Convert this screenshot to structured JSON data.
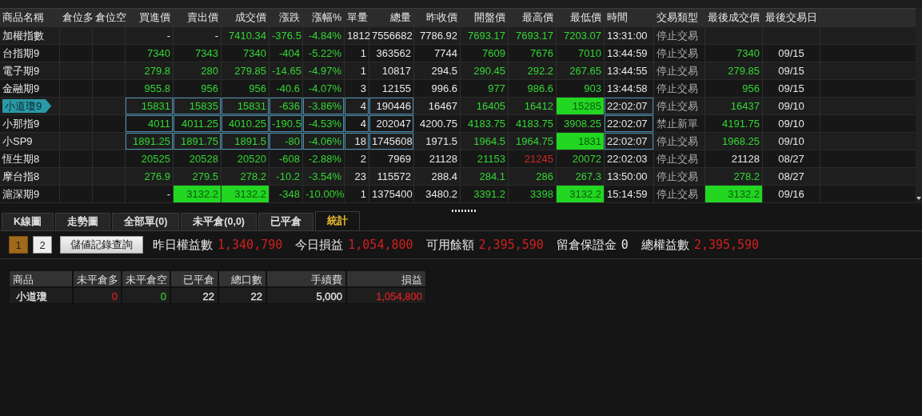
{
  "quotes": {
    "columns": [
      "商品名稱",
      "倉位多",
      "倉位空",
      "買進價",
      "賣出價",
      "成交價",
      "漲跌",
      "漲幅%",
      "單量",
      "總量",
      "昨收價",
      "開盤價",
      "最高價",
      "最低價",
      "時間",
      "交易類型",
      "最後成交價",
      "最後交易日"
    ],
    "rows": [
      {
        "selected": false,
        "boxed": false,
        "cells": [
          {
            "text": "加權指數"
          },
          "",
          "",
          {
            "text": "-",
            "highlighted": false
          },
          {
            "text": "-",
            "highlighted": false
          },
          {
            "text": "7410.34",
            "color": "#33d633",
            "highlighted": false
          },
          {
            "text": "-376.5",
            "color": "#33d633",
            "highlighted": false
          },
          {
            "text": "-4.84%",
            "color": "#33d633",
            "highlighted": false
          },
          {
            "text": "1812",
            "color": "#e8e8e8",
            "highlighted": false
          },
          {
            "text": "7556682",
            "color": "#e8e8e8",
            "highlighted": false
          },
          {
            "text": "7786.92",
            "color": "#e8e8e8",
            "highlighted": false
          },
          {
            "text": "7693.17",
            "color": "#33d633",
            "highlighted": false
          },
          {
            "text": "7693.17",
            "color": "#33d633",
            "highlighted": false
          },
          {
            "text": "7203.07",
            "color": "#33d633",
            "highlighted": false
          },
          {
            "text": "13:31:00",
            "color": "#e8e8e8",
            "highlighted": false
          },
          {
            "text": "停止交易",
            "color": "#b0b0b0",
            "highlighted": false
          },
          "",
          ""
        ]
      },
      {
        "selected": false,
        "boxed": false,
        "cells": [
          {
            "text": "台指期9"
          },
          "",
          "",
          {
            "text": "7340",
            "color": "#33d633",
            "highlighted": false
          },
          {
            "text": "7343",
            "color": "#33d633",
            "highlighted": false
          },
          {
            "text": "7340",
            "color": "#33d633",
            "highlighted": false
          },
          {
            "text": "-404",
            "color": "#33d633",
            "highlighted": false
          },
          {
            "text": "-5.22%",
            "color": "#33d633",
            "highlighted": false
          },
          {
            "text": "1",
            "color": "#e8e8e8",
            "highlighted": false
          },
          {
            "text": "363562",
            "color": "#e8e8e8",
            "highlighted": false
          },
          {
            "text": "7744",
            "color": "#e8e8e8",
            "highlighted": false
          },
          {
            "text": "7609",
            "color": "#33d633",
            "highlighted": false
          },
          {
            "text": "7676",
            "color": "#33d633",
            "highlighted": false
          },
          {
            "text": "7010",
            "color": "#33d633",
            "highlighted": false
          },
          {
            "text": "13:44:59",
            "color": "#e8e8e8",
            "highlighted": false
          },
          {
            "text": "停止交易",
            "color": "#b0b0b0",
            "highlighted": false
          },
          {
            "text": "7340",
            "color": "#33d633",
            "highlighted": false
          },
          {
            "text": "09/15",
            "color": "#e8e8e8",
            "highlighted": false
          }
        ]
      },
      {
        "selected": false,
        "boxed": false,
        "cells": [
          {
            "text": "電子期9"
          },
          "",
          "",
          {
            "text": "279.8",
            "color": "#33d633",
            "highlighted": false
          },
          {
            "text": "280",
            "color": "#33d633",
            "highlighted": false
          },
          {
            "text": "279.85",
            "color": "#33d633",
            "highlighted": false
          },
          {
            "text": "-14.65",
            "color": "#33d633",
            "highlighted": false
          },
          {
            "text": "-4.97%",
            "color": "#33d633",
            "highlighted": false
          },
          {
            "text": "1",
            "color": "#e8e8e8",
            "highlighted": false
          },
          {
            "text": "10817",
            "color": "#e8e8e8",
            "highlighted": false
          },
          {
            "text": "294.5",
            "color": "#e8e8e8",
            "highlighted": false
          },
          {
            "text": "290.45",
            "color": "#33d633",
            "highlighted": false
          },
          {
            "text": "292.2",
            "color": "#33d633",
            "highlighted": false
          },
          {
            "text": "267.65",
            "color": "#33d633",
            "highlighted": false
          },
          {
            "text": "13:44:55",
            "color": "#e8e8e8",
            "highlighted": false
          },
          {
            "text": "停止交易",
            "color": "#b0b0b0",
            "highlighted": false
          },
          {
            "text": "279.85",
            "color": "#33d633",
            "highlighted": false
          },
          {
            "text": "09/15",
            "color": "#e8e8e8",
            "highlighted": false
          }
        ]
      },
      {
        "selected": false,
        "boxed": false,
        "cells": [
          {
            "text": "金融期9"
          },
          "",
          "",
          {
            "text": "955.8",
            "color": "#33d633",
            "highlighted": false
          },
          {
            "text": "956",
            "color": "#33d633",
            "highlighted": false
          },
          {
            "text": "956",
            "color": "#33d633",
            "highlighted": false
          },
          {
            "text": "-40.6",
            "color": "#33d633",
            "highlighted": false
          },
          {
            "text": "-4.07%",
            "color": "#33d633",
            "highlighted": false
          },
          {
            "text": "3",
            "color": "#e8e8e8",
            "highlighted": false
          },
          {
            "text": "12155",
            "color": "#e8e8e8",
            "highlighted": false
          },
          {
            "text": "996.6",
            "color": "#e8e8e8",
            "highlighted": false
          },
          {
            "text": "977",
            "color": "#33d633",
            "highlighted": false
          },
          {
            "text": "986.6",
            "color": "#33d633",
            "highlighted": false
          },
          {
            "text": "903",
            "color": "#33d633",
            "highlighted": false
          },
          {
            "text": "13:44:58",
            "color": "#e8e8e8",
            "highlighted": false
          },
          {
            "text": "停止交易",
            "color": "#b0b0b0",
            "highlighted": false
          },
          {
            "text": "956",
            "color": "#33d633",
            "highlighted": false
          },
          {
            "text": "09/15",
            "color": "#e8e8e8",
            "highlighted": false
          }
        ]
      },
      {
        "selected": true,
        "boxed": true,
        "cells": [
          {
            "text": "小道瓊9"
          },
          "",
          "",
          {
            "text": "15831",
            "color": "#33d633",
            "highlighted": false
          },
          {
            "text": "15835",
            "color": "#33d633",
            "highlighted": false
          },
          {
            "text": "15831",
            "color": "#33d633",
            "highlighted": false
          },
          {
            "text": "-636",
            "color": "#33d633",
            "highlighted": false
          },
          {
            "text": "-3.86%",
            "color": "#33d633",
            "highlighted": false
          },
          {
            "text": "4",
            "color": "#e8e8e8",
            "highlighted": false
          },
          {
            "text": "190446",
            "color": "#e8e8e8",
            "highlighted": false
          },
          {
            "text": "16467",
            "color": "#e8e8e8",
            "highlighted": false
          },
          {
            "text": "16405",
            "color": "#33d633",
            "highlighted": false
          },
          {
            "text": "16412",
            "color": "#33d633",
            "highlighted": false
          },
          {
            "text": "15285",
            "color": "#0b5a0b",
            "highlighted": true
          },
          {
            "text": "22:02:07",
            "color": "#e8e8e8",
            "highlighted": false
          },
          {
            "text": "停止交易",
            "color": "#b0b0b0",
            "highlighted": false
          },
          {
            "text": "16437",
            "color": "#33d633",
            "highlighted": false
          },
          {
            "text": "09/10",
            "color": "#e8e8e8",
            "highlighted": false
          }
        ]
      },
      {
        "selected": false,
        "boxed": true,
        "cells": [
          {
            "text": "小那指9"
          },
          "",
          "",
          {
            "text": "4011",
            "color": "#33d633",
            "highlighted": false
          },
          {
            "text": "4011.25",
            "color": "#33d633",
            "highlighted": false
          },
          {
            "text": "4010.25",
            "color": "#33d633",
            "highlighted": false
          },
          {
            "text": "-190.5",
            "color": "#33d633",
            "highlighted": false
          },
          {
            "text": "-4.53%",
            "color": "#33d633",
            "highlighted": false
          },
          {
            "text": "4",
            "color": "#e8e8e8",
            "highlighted": false
          },
          {
            "text": "202047",
            "color": "#e8e8e8",
            "highlighted": false
          },
          {
            "text": "4200.75",
            "color": "#e8e8e8",
            "highlighted": false
          },
          {
            "text": "4183.75",
            "color": "#33d633",
            "highlighted": false
          },
          {
            "text": "4183.75",
            "color": "#33d633",
            "highlighted": false
          },
          {
            "text": "3908.25",
            "color": "#33d633",
            "highlighted": false
          },
          {
            "text": "22:02:07",
            "color": "#e8e8e8",
            "highlighted": false
          },
          {
            "text": "禁止新單",
            "color": "#b0b0b0",
            "highlighted": false
          },
          {
            "text": "4191.75",
            "color": "#33d633",
            "highlighted": false
          },
          {
            "text": "09/10",
            "color": "#e8e8e8",
            "highlighted": false
          }
        ]
      },
      {
        "selected": false,
        "boxed": true,
        "cells": [
          {
            "text": "小SP9"
          },
          "",
          "",
          {
            "text": "1891.25",
            "color": "#33d633",
            "highlighted": false
          },
          {
            "text": "1891.75",
            "color": "#33d633",
            "highlighted": false
          },
          {
            "text": "1891.5",
            "color": "#33d633",
            "highlighted": false
          },
          {
            "text": "-80",
            "color": "#33d633",
            "highlighted": false
          },
          {
            "text": "-4.06%",
            "color": "#33d633",
            "highlighted": false
          },
          {
            "text": "18",
            "color": "#e8e8e8",
            "highlighted": false
          },
          {
            "text": "1745608",
            "color": "#e8e8e8",
            "highlighted": false
          },
          {
            "text": "1971.5",
            "color": "#e8e8e8",
            "highlighted": false
          },
          {
            "text": "1964.5",
            "color": "#33d633",
            "highlighted": false
          },
          {
            "text": "1964.75",
            "color": "#33d633",
            "highlighted": false
          },
          {
            "text": "1831",
            "color": "#0b5a0b",
            "highlighted": true
          },
          {
            "text": "22:02:07",
            "color": "#e8e8e8",
            "highlighted": false
          },
          {
            "text": "停止交易",
            "color": "#b0b0b0",
            "highlighted": false
          },
          {
            "text": "1968.25",
            "color": "#33d633",
            "highlighted": false
          },
          {
            "text": "09/10",
            "color": "#e8e8e8",
            "highlighted": false
          }
        ]
      },
      {
        "selected": false,
        "boxed": false,
        "cells": [
          {
            "text": "恆生期8"
          },
          "",
          "",
          {
            "text": "20525",
            "color": "#33d633",
            "highlighted": false
          },
          {
            "text": "20528",
            "color": "#33d633",
            "highlighted": false
          },
          {
            "text": "20520",
            "color": "#33d633",
            "highlighted": false
          },
          {
            "text": "-608",
            "color": "#33d633",
            "highlighted": false
          },
          {
            "text": "-2.88%",
            "color": "#33d633",
            "highlighted": false
          },
          {
            "text": "2",
            "color": "#e8e8e8",
            "highlighted": false
          },
          {
            "text": "7969",
            "color": "#e8e8e8",
            "highlighted": false
          },
          {
            "text": "21128",
            "color": "#e8e8e8",
            "highlighted": false
          },
          {
            "text": "21153",
            "color": "#33d633",
            "highlighted": false
          },
          {
            "text": "21245",
            "color": "#d02828",
            "highlighted": false
          },
          {
            "text": "20072",
            "color": "#33d633",
            "highlighted": false
          },
          {
            "text": "22:02:03",
            "color": "#e8e8e8",
            "highlighted": false
          },
          {
            "text": "停止交易",
            "color": "#b0b0b0",
            "highlighted": false
          },
          {
            "text": "21128",
            "color": "#e8e8e8",
            "highlighted": false
          },
          {
            "text": "08/27",
            "color": "#e8e8e8",
            "highlighted": false
          }
        ]
      },
      {
        "selected": false,
        "boxed": false,
        "cells": [
          {
            "text": "摩台指8"
          },
          "",
          "",
          {
            "text": "276.9",
            "color": "#33d633",
            "highlighted": false
          },
          {
            "text": "279.5",
            "color": "#33d633",
            "highlighted": false
          },
          {
            "text": "278.2",
            "color": "#33d633",
            "highlighted": false
          },
          {
            "text": "-10.2",
            "color": "#33d633",
            "highlighted": false
          },
          {
            "text": "-3.54%",
            "color": "#33d633",
            "highlighted": false
          },
          {
            "text": "23",
            "color": "#e8e8e8",
            "highlighted": false
          },
          {
            "text": "115572",
            "color": "#e8e8e8",
            "highlighted": false
          },
          {
            "text": "288.4",
            "color": "#e8e8e8",
            "highlighted": false
          },
          {
            "text": "284.1",
            "color": "#33d633",
            "highlighted": false
          },
          {
            "text": "286",
            "color": "#33d633",
            "highlighted": false
          },
          {
            "text": "267.3",
            "color": "#33d633",
            "highlighted": false
          },
          {
            "text": "13:50:00",
            "color": "#e8e8e8",
            "highlighted": false
          },
          {
            "text": "停止交易",
            "color": "#b0b0b0",
            "highlighted": false
          },
          {
            "text": "278.2",
            "color": "#33d633",
            "highlighted": false
          },
          {
            "text": "08/27",
            "color": "#e8e8e8",
            "highlighted": false
          }
        ]
      },
      {
        "selected": false,
        "boxed": false,
        "cells": [
          {
            "text": "滬深期9"
          },
          "",
          "",
          {
            "text": "-",
            "highlighted": false
          },
          {
            "text": "3132.2",
            "color": "#0b5a0b",
            "highlighted": true
          },
          {
            "text": "3132.2",
            "color": "#0b5a0b",
            "highlighted": true
          },
          {
            "text": "-348",
            "color": "#33d633",
            "highlighted": false
          },
          {
            "text": "-10.00%",
            "color": "#33d633",
            "highlighted": false
          },
          {
            "text": "1",
            "color": "#e8e8e8",
            "highlighted": false
          },
          {
            "text": "1375400",
            "color": "#e8e8e8",
            "highlighted": false
          },
          {
            "text": "3480.2",
            "color": "#e8e8e8",
            "highlighted": false
          },
          {
            "text": "3391.2",
            "color": "#33d633",
            "highlighted": false
          },
          {
            "text": "3398",
            "color": "#33d633",
            "highlighted": false
          },
          {
            "text": "3132.2",
            "color": "#0b5a0b",
            "highlighted": true
          },
          {
            "text": "15:14:59",
            "color": "#e8e8e8",
            "highlighted": false
          },
          {
            "text": "停止交易",
            "color": "#b0b0b0",
            "highlighted": false
          },
          {
            "text": "3132.2",
            "color": "#0b5a0b",
            "highlighted": true
          },
          {
            "text": "09/16",
            "color": "#e8e8e8",
            "highlighted": false
          }
        ]
      }
    ]
  },
  "tabs": [
    {
      "label": "K線圖",
      "selected": false
    },
    {
      "label": "走勢圖",
      "selected": false
    },
    {
      "label": "全部單(0)",
      "selected": false
    },
    {
      "label": "未平倉(0,0)",
      "selected": false
    },
    {
      "label": "已平倉",
      "selected": false
    },
    {
      "label": "統計",
      "selected": true
    }
  ],
  "pages": [
    {
      "label": "1",
      "selected": true
    },
    {
      "label": "2",
      "selected": false
    }
  ],
  "query_button": "儲値記錄查詢",
  "summary": [
    {
      "label": "昨日權益數",
      "value": "1,340,790",
      "color": "#d02020"
    },
    {
      "label": "今日損益",
      "value": "1,054,800",
      "color": "#d02020"
    },
    {
      "label": "可用餘額",
      "value": "2,395,590",
      "color": "#d02020"
    },
    {
      "label": "留倉保證金",
      "value": "0",
      "color": "#e8e8e8"
    },
    {
      "label": "總權益數",
      "value": "2,395,590",
      "color": "#d02020"
    }
  ],
  "stats": {
    "columns": [
      "商品",
      "未平倉多",
      "未平倉空",
      "已平倉",
      "總口數",
      "手續費",
      "損益"
    ],
    "rows": [
      {
        "cells": [
          {
            "text": "小道瓊",
            "color": "#e8e8e8"
          },
          {
            "text": "0",
            "color": "#d02020"
          },
          {
            "text": "0",
            "color": "#33c033"
          },
          {
            "text": "22",
            "color": "#e8e8e8"
          },
          {
            "text": "22",
            "color": "#e8e8e8"
          },
          {
            "text": "5,000",
            "color": "#e8e8e8"
          },
          {
            "text": "1,054,800",
            "color": "#d02020"
          }
        ]
      }
    ]
  }
}
